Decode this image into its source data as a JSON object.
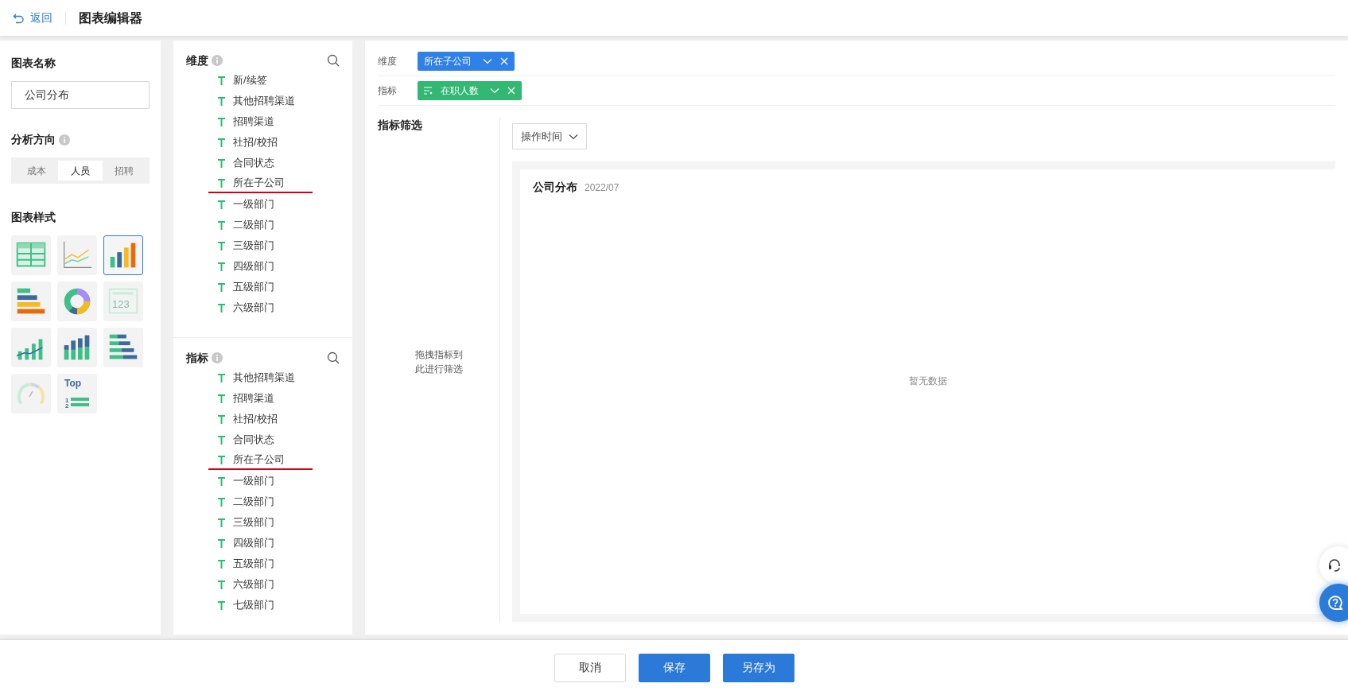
{
  "header": {
    "back": "返回",
    "title": "图表编辑器"
  },
  "settings": {
    "name_label": "图表名称",
    "name_value": "公司分布",
    "direction_label": "分析方向",
    "directions": [
      {
        "label": "成本",
        "selected": false
      },
      {
        "label": "人员",
        "selected": true
      },
      {
        "label": "招聘",
        "selected": false
      }
    ],
    "style_label": "图表样式",
    "styles": [
      {
        "kind": "table",
        "selected": false
      },
      {
        "kind": "line",
        "selected": false
      },
      {
        "kind": "bar",
        "selected": true
      },
      {
        "kind": "hbar",
        "selected": false
      },
      {
        "kind": "donut",
        "selected": false
      },
      {
        "kind": "number",
        "selected": false,
        "text": "123"
      },
      {
        "kind": "combo",
        "selected": false
      },
      {
        "kind": "stacked",
        "selected": false
      },
      {
        "kind": "stackedh",
        "selected": false
      },
      {
        "kind": "gauge",
        "selected": false
      },
      {
        "kind": "top",
        "selected": false,
        "text": "Top",
        "ranks": [
          "1",
          "2"
        ]
      }
    ]
  },
  "fields": [
    {
      "title": "维度",
      "items": [
        {
          "label": "新/续签",
          "underlined": false
        },
        {
          "label": "其他招聘渠道",
          "underlined": false
        },
        {
          "label": "招聘渠道",
          "underlined": false
        },
        {
          "label": "社招/校招",
          "underlined": false
        },
        {
          "label": "合同状态",
          "underlined": false
        },
        {
          "label": "所在子公司",
          "underlined": true
        },
        {
          "label": "一级部门",
          "underlined": false
        },
        {
          "label": "二级部门",
          "underlined": false
        },
        {
          "label": "三级部门",
          "underlined": false
        },
        {
          "label": "四级部门",
          "underlined": false
        },
        {
          "label": "五级部门",
          "underlined": false
        },
        {
          "label": "六级部门",
          "underlined": false
        }
      ]
    },
    {
      "title": "指标",
      "items": [
        {
          "label": "其他招聘渠道",
          "underlined": false
        },
        {
          "label": "招聘渠道",
          "underlined": false
        },
        {
          "label": "社招/校招",
          "underlined": false
        },
        {
          "label": "合同状态",
          "underlined": false
        },
        {
          "label": "所在子公司",
          "underlined": true
        },
        {
          "label": "一级部门",
          "underlined": false
        },
        {
          "label": "二级部门",
          "underlined": false
        },
        {
          "label": "三级部门",
          "underlined": false
        },
        {
          "label": "四级部门",
          "underlined": false
        },
        {
          "label": "五级部门",
          "underlined": false
        },
        {
          "label": "六级部门",
          "underlined": false
        },
        {
          "label": "七级部门",
          "underlined": false
        }
      ]
    }
  ],
  "slots": [
    {
      "label": "维度",
      "chip": "所在子公司",
      "kind": "dimension"
    },
    {
      "label": "指标",
      "chip": "在职人数",
      "kind": "metric"
    }
  ],
  "filter": {
    "title": "指标筛选",
    "hint": "拖拽指标到此进行筛选",
    "dropdown": "操作时间"
  },
  "chart": {
    "title": "公司分布",
    "date": "2022/07",
    "empty": "暂无数据"
  },
  "footer": {
    "buttons": [
      {
        "label": "取消",
        "kind": "secondary"
      },
      {
        "label": "保存",
        "kind": "primary"
      },
      {
        "label": "另存为",
        "kind": "primary"
      }
    ]
  }
}
